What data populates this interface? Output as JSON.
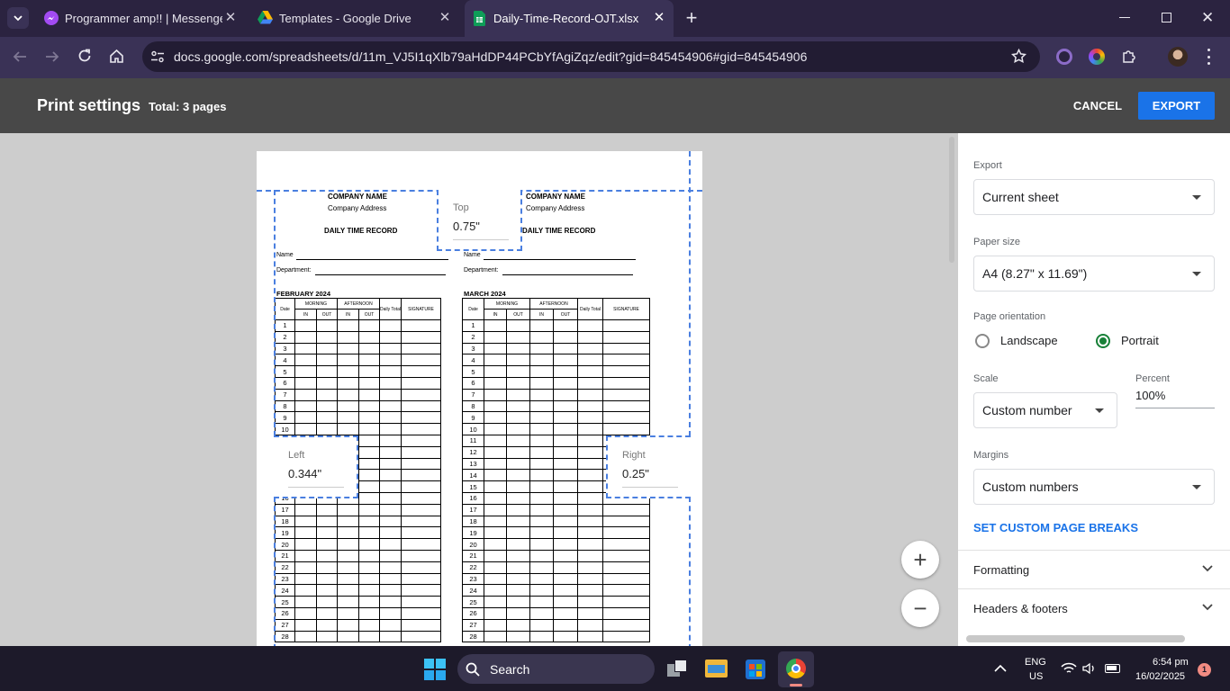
{
  "browser": {
    "tabs": [
      {
        "title": "Programmer amp!! | Messenger",
        "icon": "messenger-icon"
      },
      {
        "title": "Templates - Google Drive",
        "icon": "google-drive-icon"
      },
      {
        "title": "Daily-Time-Record-OJT.xlsx - Go",
        "icon": "google-sheets-icon",
        "active": true
      }
    ],
    "url": "docs.google.com/spreadsheets/d/11m_VJ5I1qXlb79aHdDP44PCbYfAgiZqz/edit?gid=845454906#gid=845454906"
  },
  "print": {
    "title": "Print settings",
    "total": "Total: 3 pages",
    "cancel": "CANCEL",
    "export": "EXPORT"
  },
  "margins": {
    "top": {
      "label": "Top",
      "value": "0.75\""
    },
    "left": {
      "label": "Left",
      "value": "0.344\""
    },
    "right": {
      "label": "Right",
      "value": "0.25\""
    }
  },
  "sheet": {
    "company_name": "COMPANY NAME",
    "company_address": "Company Address",
    "record_title": "DAILY TIME RECORD",
    "name_label": "Name",
    "department_label": "Department:",
    "col_date": "Date",
    "col_morning": "MORNING",
    "col_afternoon": "AFTERNOON",
    "col_in": "IN",
    "col_out": "OUT",
    "col_daily": "Daily Total",
    "col_signature": "SIGNATURE",
    "left_month": "FEBRUARY 2024",
    "right_month": "MARCH 2024"
  },
  "panel": {
    "export_label": "Export",
    "export_value": "Current sheet",
    "paper_label": "Paper size",
    "paper_value": "A4 (8.27\" x 11.69\")",
    "orientation_label": "Page orientation",
    "landscape": "Landscape",
    "portrait": "Portrait",
    "scale_label": "Scale",
    "scale_value": "Custom number",
    "percent_label": "Percent",
    "percent_value": "100%",
    "margins_label": "Margins",
    "margins_value": "Custom numbers",
    "page_breaks": "SET CUSTOM PAGE BREAKS",
    "formatting": "Formatting",
    "headers": "Headers & footers"
  },
  "taskbar": {
    "search": "Search",
    "lang1": "ENG",
    "lang2": "US",
    "time": "6:54 pm",
    "date": "16/02/2025",
    "badge": "1"
  },
  "colors": {
    "accent": "#1a73e8",
    "radio_on": "#188038",
    "margin_dash": "#4a7fe0"
  }
}
